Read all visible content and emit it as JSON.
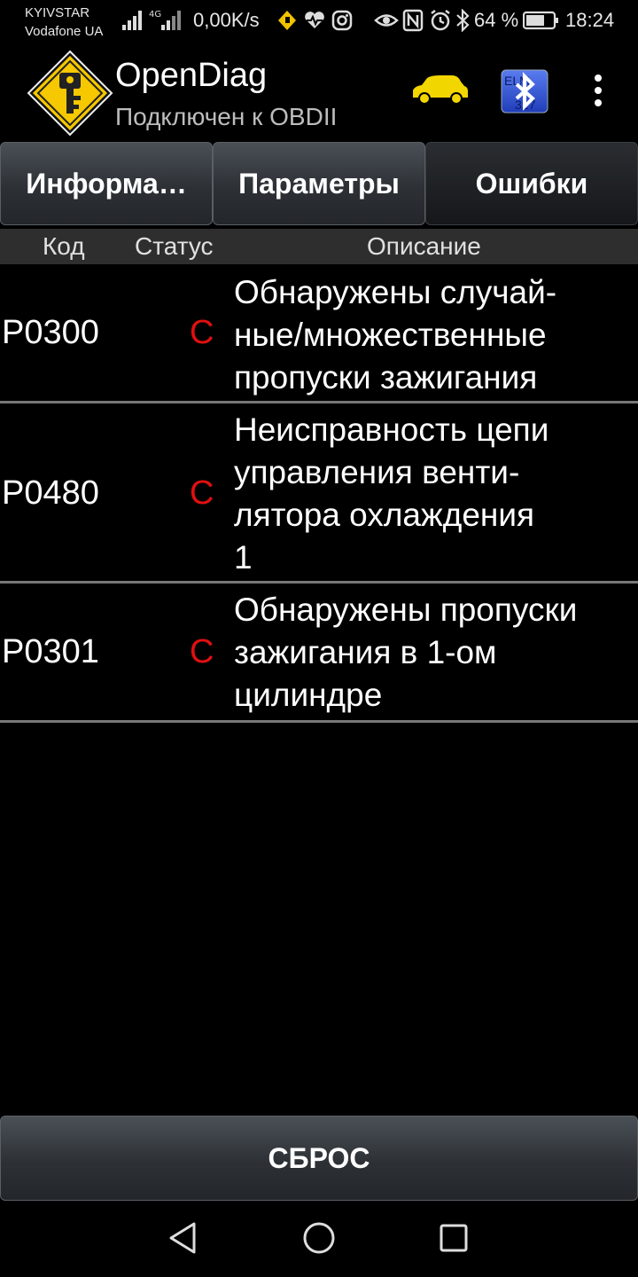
{
  "status_bar": {
    "carrier_1": "KYIVSTAR",
    "carrier_2": "Vodafone UA",
    "network_speed": "0,00K/s",
    "battery": "64 %",
    "time": "18:24",
    "icons": [
      "signal-icon",
      "signal-4g-icon",
      "navigation-app-icon",
      "health-icon",
      "instagram-icon",
      "eye-icon",
      "nfc-icon",
      "alarm-icon",
      "bluetooth-icon",
      "battery-icon"
    ]
  },
  "app_bar": {
    "title": "OpenDiag",
    "subtitle": "Подключен к OBDII",
    "car_color": "#f2d600"
  },
  "tabs": [
    {
      "label": "Информа…",
      "active": false
    },
    {
      "label": "Параметры",
      "active": false
    },
    {
      "label": "Ошибки",
      "active": true
    }
  ],
  "table": {
    "headers": {
      "code": "Код",
      "status": "Статус",
      "description": "Описание"
    },
    "rows": [
      {
        "code": "P0300",
        "status": "C",
        "description": [
          "Обнаружены случай-",
          "ные/множественные",
          "пропуски зажигания"
        ]
      },
      {
        "code": "P0480",
        "status": "C",
        "description": [
          "Неисправность цепи",
          "управления венти-",
          "лятора охлаждения",
          "1"
        ]
      },
      {
        "code": "P0301",
        "status": "C",
        "description": [
          "Обнаружены пропуски",
          "зажигания в 1-ом",
          "цилиндре"
        ]
      }
    ]
  },
  "reset_button": {
    "label": "СБРОС"
  },
  "colors": {
    "status_error": "#e01010",
    "background": "#000000",
    "header_bg": "#2e2e2e"
  }
}
